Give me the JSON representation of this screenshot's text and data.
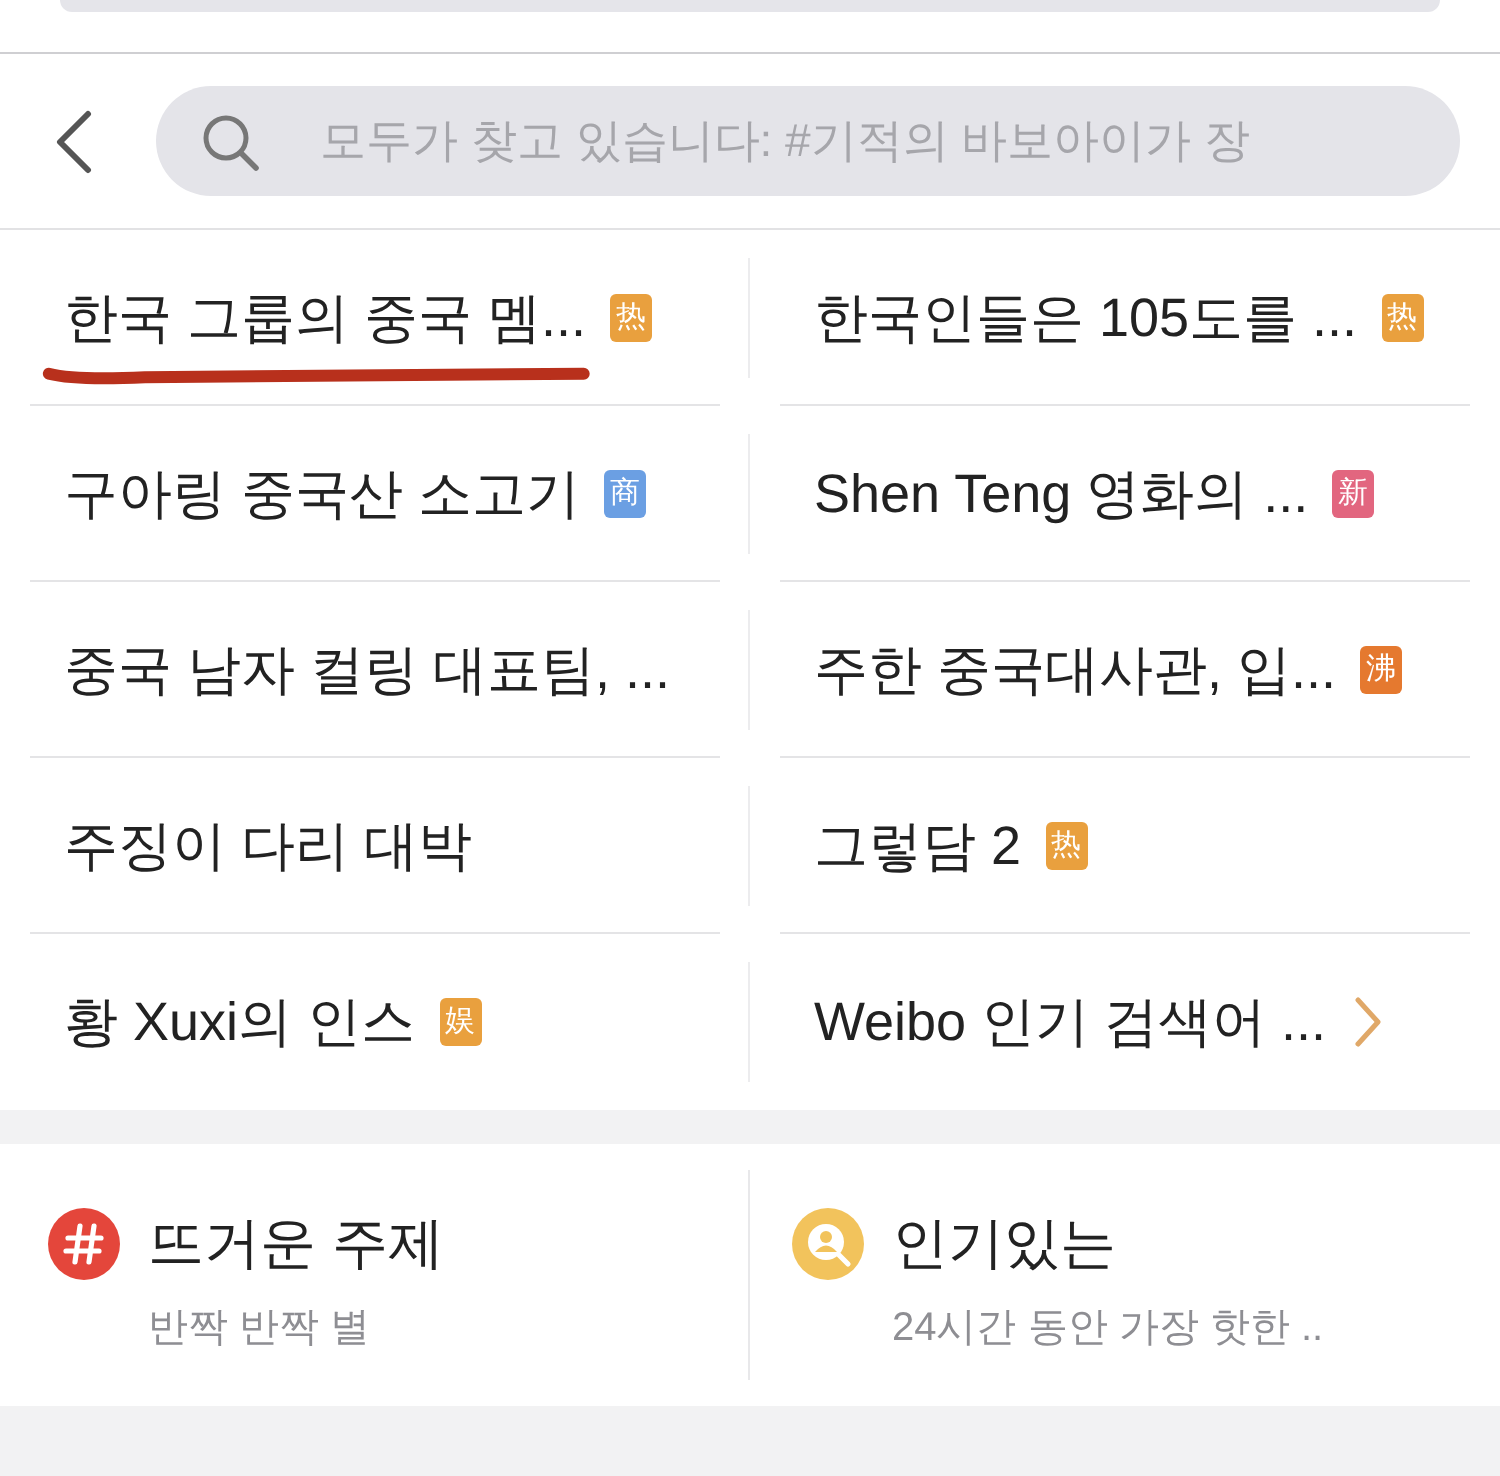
{
  "search": {
    "placeholder": "모두가 찾고 있습니다: #기적의 바보아이가 장"
  },
  "trending": [
    {
      "kind": "topic",
      "title": "한국 그룹의 중국 멤...",
      "badge": "热",
      "color": "#e9a03e",
      "underlined": true
    },
    {
      "kind": "topic",
      "title": "한국인들은 105도를 ...",
      "badge": "热",
      "color": "#e9a03e",
      "underlined": false
    },
    {
      "kind": "topic",
      "title": "구아링 중국산 소고기",
      "badge": "商",
      "color": "#6b9fe3",
      "underlined": false
    },
    {
      "kind": "topic",
      "title": "Shen Teng 영화의 ...",
      "badge": "新",
      "color": "#e2667f",
      "underlined": false
    },
    {
      "kind": "topic",
      "title": "중국 남자 컬링 대표팀, ...",
      "underlined": false
    },
    {
      "kind": "topic",
      "title": "주한 중국대사관, 입...",
      "badge": "沸",
      "color": "#e5792f",
      "underlined": false
    },
    {
      "kind": "topic",
      "title": "주징이 다리 대박",
      "underlined": false
    },
    {
      "kind": "topic",
      "title": "그렇담 2",
      "badge": "热",
      "color": "#e9a03e",
      "underlined": false
    },
    {
      "kind": "topic",
      "title": "황 Xuxi의 인스",
      "badge": "娱",
      "color": "#e9a03e",
      "underlined": false
    },
    {
      "kind": "more",
      "title": "Weibo 인기 검색어 ...",
      "underlined": false
    }
  ],
  "sections": [
    {
      "kind": "hashtag",
      "title": "뜨거운 주제",
      "subtitle": "반짝 반짝 별"
    },
    {
      "kind": "popular",
      "title": "인기있는",
      "subtitle": "24시간 동안 가장 핫한 .."
    }
  ]
}
